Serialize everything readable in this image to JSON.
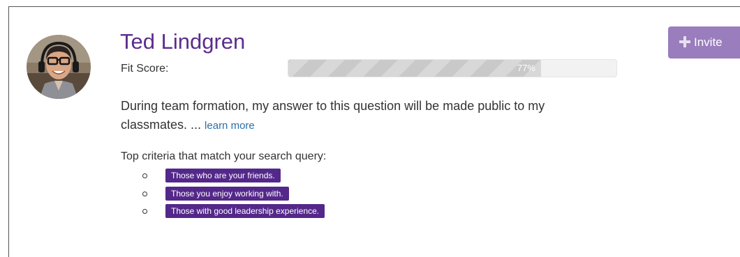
{
  "profile": {
    "name": "Ted Lindgren",
    "fit_label": "Fit Score:",
    "fit_percent": 77,
    "fit_text": "77%"
  },
  "actions": {
    "invite_label": "Invite",
    "invite_icon": "plus-icon"
  },
  "description": {
    "text": "During team formation, my answer to this question will be made public to my classmates. ... ",
    "link_text": "learn more"
  },
  "criteria": {
    "title": "Top criteria that match your search query:",
    "items": [
      "Those who are your friends.",
      "Those you enjoy working with.",
      "Those with good leadership experience."
    ]
  },
  "colors": {
    "name": "#5b2d8c",
    "invite_button": "#9a7dbd",
    "tag": "#54288a",
    "link": "#2a6fa8",
    "progress_fill": "#c9c9c9"
  }
}
